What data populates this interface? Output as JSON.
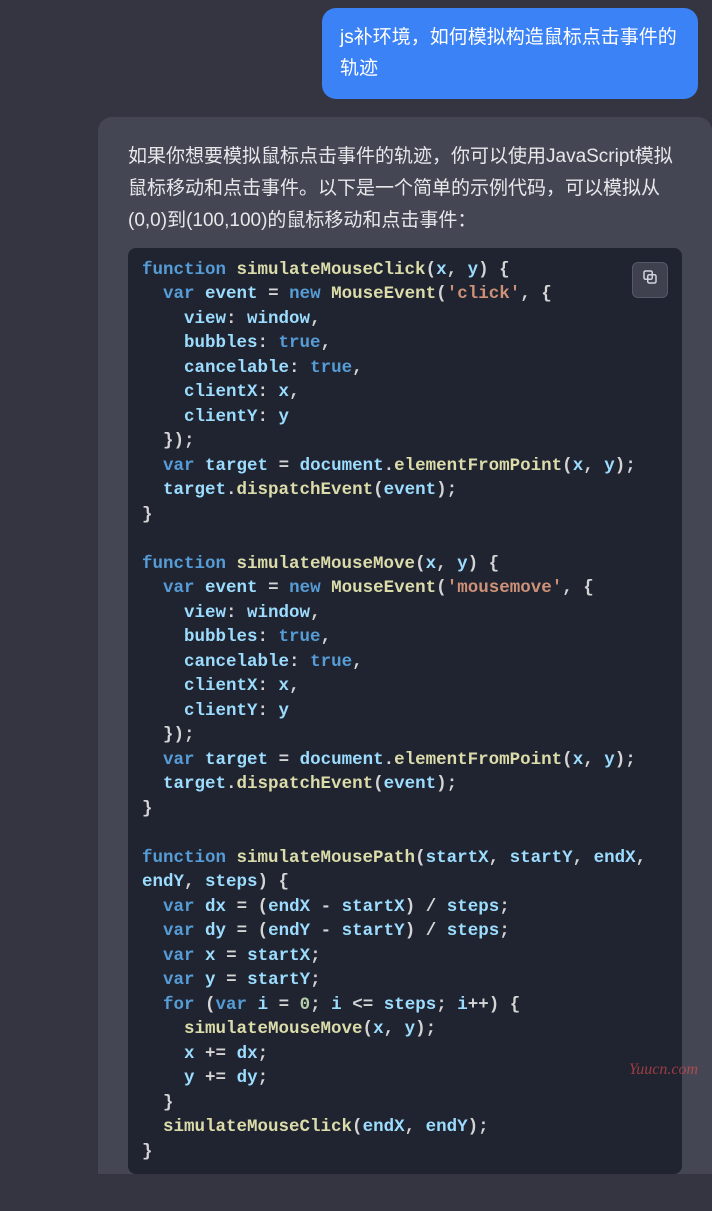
{
  "user": {
    "message": "js补环境，如何模拟构造鼠标点击事件的轨迹"
  },
  "assistant": {
    "intro": "如果你想要模拟鼠标点击事件的轨迹，你可以使用JavaScript模拟鼠标移动和点击事件。以下是一个简单的示例代码，可以模拟从(0,0)到(100,100)的鼠标移动和点击事件：",
    "code_tokens": [
      [
        "kw",
        "function"
      ],
      [
        "pn",
        " "
      ],
      [
        "fn",
        "simulateMouseClick"
      ],
      [
        "pn",
        "("
      ],
      [
        "id",
        "x"
      ],
      [
        "pn",
        ", "
      ],
      [
        "id",
        "y"
      ],
      [
        "pn",
        ") {"
      ],
      [
        "nl",
        ""
      ],
      [
        "pn",
        "  "
      ],
      [
        "kw",
        "var"
      ],
      [
        "pn",
        " "
      ],
      [
        "id",
        "event"
      ],
      [
        "pn",
        " "
      ],
      [
        "op",
        "="
      ],
      [
        "pn",
        " "
      ],
      [
        "kw",
        "new"
      ],
      [
        "pn",
        " "
      ],
      [
        "fn",
        "MouseEvent"
      ],
      [
        "pn",
        "("
      ],
      [
        "str",
        "'click'"
      ],
      [
        "pn",
        ", {"
      ],
      [
        "nl",
        ""
      ],
      [
        "pn",
        "    "
      ],
      [
        "id",
        "view"
      ],
      [
        "pn",
        ": "
      ],
      [
        "id",
        "window"
      ],
      [
        "pn",
        ","
      ],
      [
        "nl",
        ""
      ],
      [
        "pn",
        "    "
      ],
      [
        "id",
        "bubbles"
      ],
      [
        "pn",
        ": "
      ],
      [
        "kw",
        "true"
      ],
      [
        "pn",
        ","
      ],
      [
        "nl",
        ""
      ],
      [
        "pn",
        "    "
      ],
      [
        "id",
        "cancelable"
      ],
      [
        "pn",
        ": "
      ],
      [
        "kw",
        "true"
      ],
      [
        "pn",
        ","
      ],
      [
        "nl",
        ""
      ],
      [
        "pn",
        "    "
      ],
      [
        "id",
        "clientX"
      ],
      [
        "pn",
        ": "
      ],
      [
        "id",
        "x"
      ],
      [
        "pn",
        ","
      ],
      [
        "nl",
        ""
      ],
      [
        "pn",
        "    "
      ],
      [
        "id",
        "clientY"
      ],
      [
        "pn",
        ": "
      ],
      [
        "id",
        "y"
      ],
      [
        "nl",
        ""
      ],
      [
        "pn",
        "  });"
      ],
      [
        "nl",
        ""
      ],
      [
        "pn",
        "  "
      ],
      [
        "kw",
        "var"
      ],
      [
        "pn",
        " "
      ],
      [
        "id",
        "target"
      ],
      [
        "pn",
        " "
      ],
      [
        "op",
        "="
      ],
      [
        "pn",
        " "
      ],
      [
        "id",
        "document"
      ],
      [
        "pn",
        "."
      ],
      [
        "fn",
        "elementFromPoint"
      ],
      [
        "pn",
        "("
      ],
      [
        "id",
        "x"
      ],
      [
        "pn",
        ", "
      ],
      [
        "id",
        "y"
      ],
      [
        "pn",
        ");"
      ],
      [
        "nl",
        ""
      ],
      [
        "pn",
        "  "
      ],
      [
        "id",
        "target"
      ],
      [
        "pn",
        "."
      ],
      [
        "fn",
        "dispatchEvent"
      ],
      [
        "pn",
        "("
      ],
      [
        "id",
        "event"
      ],
      [
        "pn",
        ");"
      ],
      [
        "nl",
        ""
      ],
      [
        "pn",
        "}"
      ],
      [
        "nl",
        ""
      ],
      [
        "nl",
        ""
      ],
      [
        "kw",
        "function"
      ],
      [
        "pn",
        " "
      ],
      [
        "fn",
        "simulateMouseMove"
      ],
      [
        "pn",
        "("
      ],
      [
        "id",
        "x"
      ],
      [
        "pn",
        ", "
      ],
      [
        "id",
        "y"
      ],
      [
        "pn",
        ") {"
      ],
      [
        "nl",
        ""
      ],
      [
        "pn",
        "  "
      ],
      [
        "kw",
        "var"
      ],
      [
        "pn",
        " "
      ],
      [
        "id",
        "event"
      ],
      [
        "pn",
        " "
      ],
      [
        "op",
        "="
      ],
      [
        "pn",
        " "
      ],
      [
        "kw",
        "new"
      ],
      [
        "pn",
        " "
      ],
      [
        "fn",
        "MouseEvent"
      ],
      [
        "pn",
        "("
      ],
      [
        "str",
        "'mousemove'"
      ],
      [
        "pn",
        ", {"
      ],
      [
        "nl",
        ""
      ],
      [
        "pn",
        "    "
      ],
      [
        "id",
        "view"
      ],
      [
        "pn",
        ": "
      ],
      [
        "id",
        "window"
      ],
      [
        "pn",
        ","
      ],
      [
        "nl",
        ""
      ],
      [
        "pn",
        "    "
      ],
      [
        "id",
        "bubbles"
      ],
      [
        "pn",
        ": "
      ],
      [
        "kw",
        "true"
      ],
      [
        "pn",
        ","
      ],
      [
        "nl",
        ""
      ],
      [
        "pn",
        "    "
      ],
      [
        "id",
        "cancelable"
      ],
      [
        "pn",
        ": "
      ],
      [
        "kw",
        "true"
      ],
      [
        "pn",
        ","
      ],
      [
        "nl",
        ""
      ],
      [
        "pn",
        "    "
      ],
      [
        "id",
        "clientX"
      ],
      [
        "pn",
        ": "
      ],
      [
        "id",
        "x"
      ],
      [
        "pn",
        ","
      ],
      [
        "nl",
        ""
      ],
      [
        "pn",
        "    "
      ],
      [
        "id",
        "clientY"
      ],
      [
        "pn",
        ": "
      ],
      [
        "id",
        "y"
      ],
      [
        "nl",
        ""
      ],
      [
        "pn",
        "  });"
      ],
      [
        "nl",
        ""
      ],
      [
        "pn",
        "  "
      ],
      [
        "kw",
        "var"
      ],
      [
        "pn",
        " "
      ],
      [
        "id",
        "target"
      ],
      [
        "pn",
        " "
      ],
      [
        "op",
        "="
      ],
      [
        "pn",
        " "
      ],
      [
        "id",
        "document"
      ],
      [
        "pn",
        "."
      ],
      [
        "fn",
        "elementFromPoint"
      ],
      [
        "pn",
        "("
      ],
      [
        "id",
        "x"
      ],
      [
        "pn",
        ", "
      ],
      [
        "id",
        "y"
      ],
      [
        "pn",
        ");"
      ],
      [
        "nl",
        ""
      ],
      [
        "pn",
        "  "
      ],
      [
        "id",
        "target"
      ],
      [
        "pn",
        "."
      ],
      [
        "fn",
        "dispatchEvent"
      ],
      [
        "pn",
        "("
      ],
      [
        "id",
        "event"
      ],
      [
        "pn",
        ");"
      ],
      [
        "nl",
        ""
      ],
      [
        "pn",
        "}"
      ],
      [
        "nl",
        ""
      ],
      [
        "nl",
        ""
      ],
      [
        "kw",
        "function"
      ],
      [
        "pn",
        " "
      ],
      [
        "fn",
        "simulateMousePath"
      ],
      [
        "pn",
        "("
      ],
      [
        "id",
        "startX"
      ],
      [
        "pn",
        ", "
      ],
      [
        "id",
        "startY"
      ],
      [
        "pn",
        ", "
      ],
      [
        "id",
        "endX"
      ],
      [
        "pn",
        ", "
      ],
      [
        "id",
        "endY"
      ],
      [
        "pn",
        ", "
      ],
      [
        "id",
        "steps"
      ],
      [
        "pn",
        ") {"
      ],
      [
        "nl",
        ""
      ],
      [
        "pn",
        "  "
      ],
      [
        "kw",
        "var"
      ],
      [
        "pn",
        " "
      ],
      [
        "id",
        "dx"
      ],
      [
        "pn",
        " "
      ],
      [
        "op",
        "="
      ],
      [
        "pn",
        " ("
      ],
      [
        "id",
        "endX"
      ],
      [
        "pn",
        " "
      ],
      [
        "op",
        "-"
      ],
      [
        "pn",
        " "
      ],
      [
        "id",
        "startX"
      ],
      [
        "pn",
        ") "
      ],
      [
        "op",
        "/"
      ],
      [
        "pn",
        " "
      ],
      [
        "id",
        "steps"
      ],
      [
        "pn",
        ";"
      ],
      [
        "nl",
        ""
      ],
      [
        "pn",
        "  "
      ],
      [
        "kw",
        "var"
      ],
      [
        "pn",
        " "
      ],
      [
        "id",
        "dy"
      ],
      [
        "pn",
        " "
      ],
      [
        "op",
        "="
      ],
      [
        "pn",
        " ("
      ],
      [
        "id",
        "endY"
      ],
      [
        "pn",
        " "
      ],
      [
        "op",
        "-"
      ],
      [
        "pn",
        " "
      ],
      [
        "id",
        "startY"
      ],
      [
        "pn",
        ") "
      ],
      [
        "op",
        "/"
      ],
      [
        "pn",
        " "
      ],
      [
        "id",
        "steps"
      ],
      [
        "pn",
        ";"
      ],
      [
        "nl",
        ""
      ],
      [
        "pn",
        "  "
      ],
      [
        "kw",
        "var"
      ],
      [
        "pn",
        " "
      ],
      [
        "id",
        "x"
      ],
      [
        "pn",
        " "
      ],
      [
        "op",
        "="
      ],
      [
        "pn",
        " "
      ],
      [
        "id",
        "startX"
      ],
      [
        "pn",
        ";"
      ],
      [
        "nl",
        ""
      ],
      [
        "pn",
        "  "
      ],
      [
        "kw",
        "var"
      ],
      [
        "pn",
        " "
      ],
      [
        "id",
        "y"
      ],
      [
        "pn",
        " "
      ],
      [
        "op",
        "="
      ],
      [
        "pn",
        " "
      ],
      [
        "id",
        "startY"
      ],
      [
        "pn",
        ";"
      ],
      [
        "nl",
        ""
      ],
      [
        "pn",
        "  "
      ],
      [
        "kw",
        "for"
      ],
      [
        "pn",
        " ("
      ],
      [
        "kw",
        "var"
      ],
      [
        "pn",
        " "
      ],
      [
        "id",
        "i"
      ],
      [
        "pn",
        " "
      ],
      [
        "op",
        "="
      ],
      [
        "pn",
        " "
      ],
      [
        "num",
        "0"
      ],
      [
        "pn",
        "; "
      ],
      [
        "id",
        "i"
      ],
      [
        "pn",
        " "
      ],
      [
        "op",
        "<="
      ],
      [
        "pn",
        " "
      ],
      [
        "id",
        "steps"
      ],
      [
        "pn",
        "; "
      ],
      [
        "id",
        "i"
      ],
      [
        "op",
        "++"
      ],
      [
        "pn",
        ") {"
      ],
      [
        "nl",
        ""
      ],
      [
        "pn",
        "    "
      ],
      [
        "fn",
        "simulateMouseMove"
      ],
      [
        "pn",
        "("
      ],
      [
        "id",
        "x"
      ],
      [
        "pn",
        ", "
      ],
      [
        "id",
        "y"
      ],
      [
        "pn",
        ");"
      ],
      [
        "nl",
        ""
      ],
      [
        "pn",
        "    "
      ],
      [
        "id",
        "x"
      ],
      [
        "pn",
        " "
      ],
      [
        "op",
        "+="
      ],
      [
        "pn",
        " "
      ],
      [
        "id",
        "dx"
      ],
      [
        "pn",
        ";"
      ],
      [
        "nl",
        ""
      ],
      [
        "pn",
        "    "
      ],
      [
        "id",
        "y"
      ],
      [
        "pn",
        " "
      ],
      [
        "op",
        "+="
      ],
      [
        "pn",
        " "
      ],
      [
        "id",
        "dy"
      ],
      [
        "pn",
        ";"
      ],
      [
        "nl",
        ""
      ],
      [
        "pn",
        "  }"
      ],
      [
        "nl",
        ""
      ],
      [
        "pn",
        "  "
      ],
      [
        "fn",
        "simulateMouseClick"
      ],
      [
        "pn",
        "("
      ],
      [
        "id",
        "endX"
      ],
      [
        "pn",
        ", "
      ],
      [
        "id",
        "endY"
      ],
      [
        "pn",
        ");"
      ],
      [
        "nl",
        ""
      ],
      [
        "pn",
        "}"
      ]
    ]
  },
  "watermark": "Yuucn.com"
}
